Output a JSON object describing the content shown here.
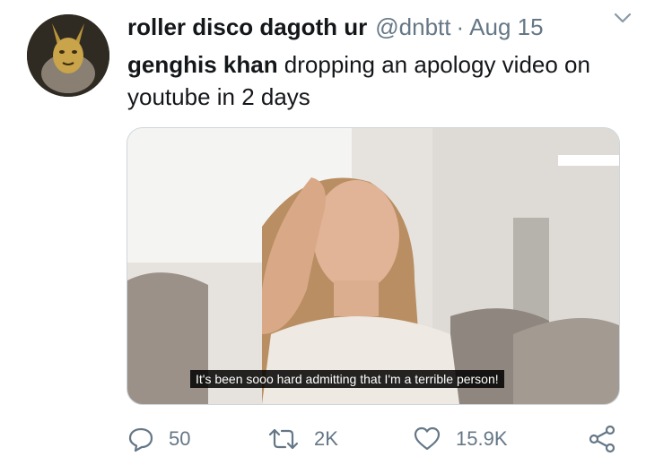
{
  "tweet": {
    "display_name": "roller disco dagoth ur",
    "handle": "@dnbtt",
    "separator": "·",
    "date": "Aug 15",
    "text_bold": "genghis khan",
    "text_rest": " dropping an apology video on youtube in 2 days",
    "media_caption": "It's been sooo hard admitting that I'm a terrible person!"
  },
  "actions": {
    "replies": "50",
    "retweets": "2K",
    "likes": "15.9K"
  },
  "icons": {
    "avatar": "golden-mask-avatar",
    "menu": "chevron-down-icon",
    "reply": "reply-icon",
    "retweet": "retweet-icon",
    "like": "heart-icon",
    "share": "share-icon"
  },
  "colors": {
    "text": "#14171a",
    "muted": "#657786",
    "border": "#ccd6dd"
  }
}
